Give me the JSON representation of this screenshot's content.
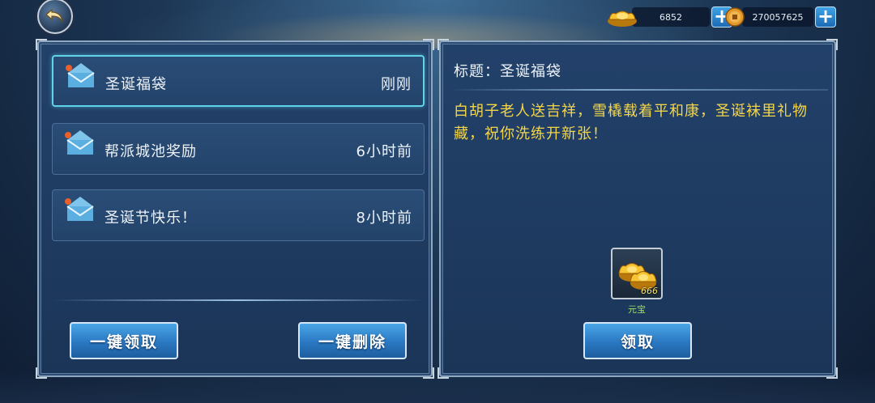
{
  "currency": {
    "ingot_icon": "gold-ingot-icon",
    "ingot_amount": "6852",
    "coin_icon": "copper-coin-icon",
    "coin_amount": "270057625",
    "plus": "+"
  },
  "mail_list": {
    "items": [
      {
        "title": "圣诞福袋",
        "time": "刚刚",
        "icon": "mail-envelope-icon",
        "unread": true,
        "selected": true
      },
      {
        "title": "帮派城池奖励",
        "time": "6小时前",
        "icon": "mail-envelope-icon",
        "unread": true,
        "selected": false
      },
      {
        "title": "圣诞节快乐！",
        "time": "8小时前",
        "icon": "mail-envelope-icon",
        "unread": true,
        "selected": false
      }
    ],
    "claim_all_label": "一键领取",
    "delete_all_label": "一键删除"
  },
  "mail_detail": {
    "title_line": "标题：圣诞福袋",
    "body": "白胡子老人送吉祥，雪橇载着平和康，圣诞袜里礼物藏，祝你洗练开新张！",
    "reward": {
      "name": "元宝",
      "count": "666",
      "icon": "gold-ingot-icon"
    },
    "claim_label": "领取"
  },
  "colors": {
    "accent": "#5fd4e8",
    "body_text": "#f3d54a",
    "reward_name": "#9ee05a",
    "unread_dot": "#e8602c"
  }
}
